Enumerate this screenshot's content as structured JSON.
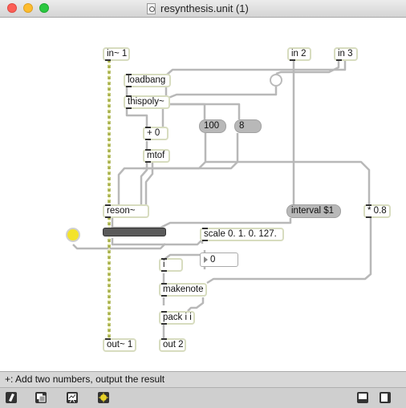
{
  "window": {
    "title": "resynthesis.unit (1)"
  },
  "objects": {
    "in1": "in~ 1",
    "in2": "in 2",
    "in3": "in 3",
    "loadbang": "loadbang",
    "thispoly": "thispoly~",
    "plus": "+ 0",
    "mtof": "mtof",
    "reson": "reson~",
    "interval": "interval $1",
    "times": "* 0.8",
    "scale": "scale 0. 1. 0. 127.",
    "i": "i",
    "makenote": "makenote",
    "pack": "pack i i",
    "out1": "out~ 1",
    "out2": "out 2"
  },
  "messages": {
    "m100": "100",
    "m8": "8"
  },
  "number_box": {
    "value": "0"
  },
  "status_text": "+: Add two numbers, output the result",
  "toolbar_icons": [
    "edit-lock-icon",
    "presentation-icon",
    "debug-icon",
    "inspector-icon",
    "patcher-view-icon",
    "sidebar-icon"
  ],
  "colors": {
    "signal_cord": "#a7b04a",
    "control_cord": "#b8b8b8",
    "object_border": "#d7dcbf",
    "led": "#f3e32c"
  }
}
